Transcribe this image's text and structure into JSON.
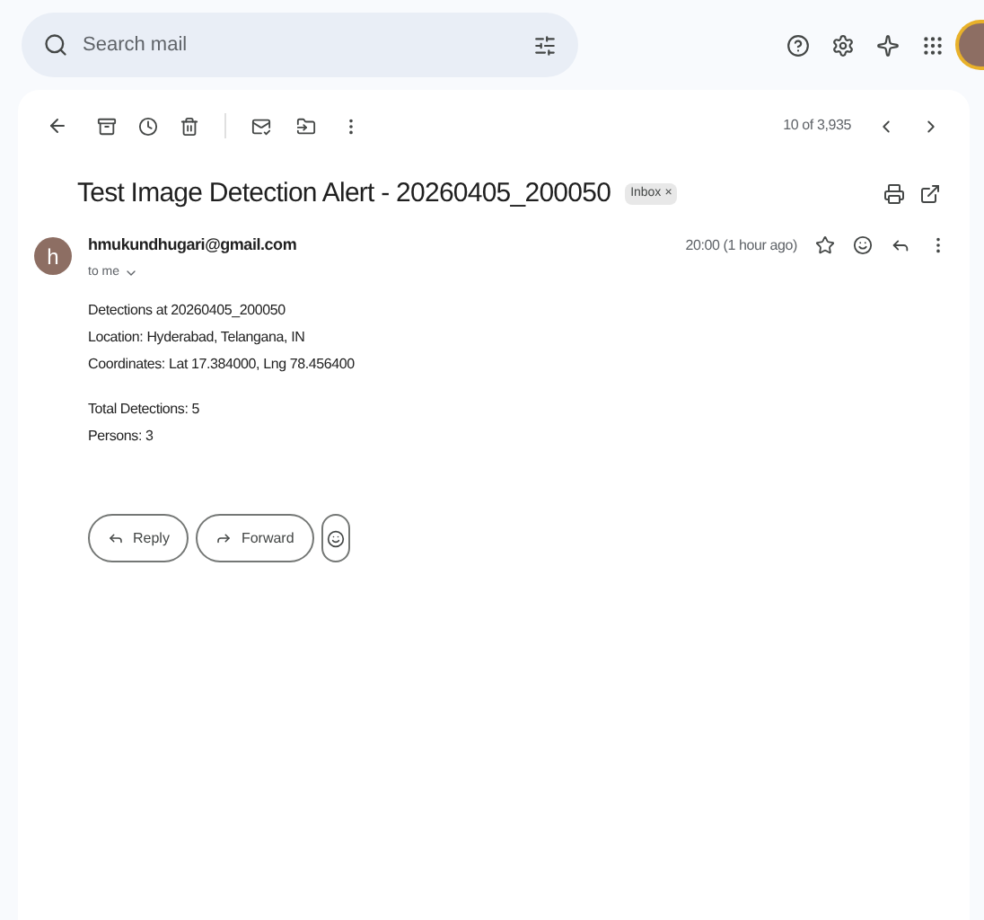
{
  "search": {
    "placeholder": "Search mail"
  },
  "toolbar": {
    "count": "10 of 3,935"
  },
  "message": {
    "subject": "Test Image Detection Alert - 20260405_200050",
    "label": "Inbox",
    "label_close": "×",
    "avatar_letter": "h",
    "sender": "hmukundhugari@gmail.com",
    "recipient": "to me",
    "time": "20:00 (1 hour ago)",
    "body": [
      [
        "Detections at 20260405_200050",
        "Location: Hyderabad, Telangana, IN",
        "Coordinates: Lat 17.384000, Lng 78.456400"
      ],
      [
        "Total Detections: 5",
        "Persons: 3"
      ]
    ]
  },
  "actions": [
    "Reply",
    "Forward"
  ]
}
